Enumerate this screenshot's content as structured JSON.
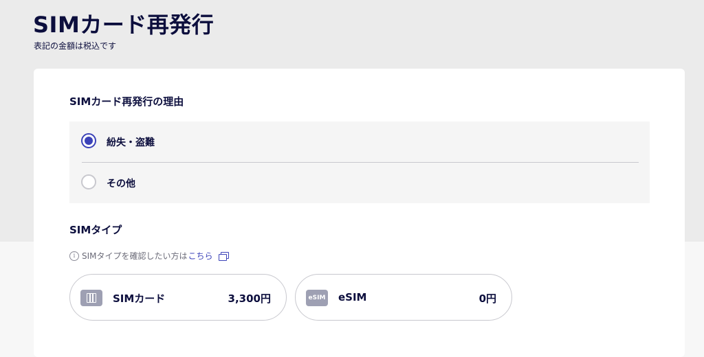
{
  "header": {
    "title": "SIMカード再発行",
    "tax_note": "表記の金額は税込です"
  },
  "reason_section": {
    "title": "SIMカード再発行の理由",
    "options": [
      {
        "label": "紛失・盗難",
        "selected": true
      },
      {
        "label": "その他",
        "selected": false
      }
    ]
  },
  "sim_type_section": {
    "title": "SIMタイプ",
    "hint_text": "SIMタイプを確認したい方は",
    "hint_link": "こちら",
    "options": [
      {
        "name": "SIMカード",
        "price": "3,300円",
        "icon": "sim-card-icon"
      },
      {
        "name": "eSIM",
        "price": "0円",
        "icon": "esim-icon",
        "icon_text": "eSIM"
      }
    ]
  },
  "colors": {
    "accent": "#3b42b8",
    "text": "#0c0e3d",
    "border": "#c8c8ce"
  }
}
